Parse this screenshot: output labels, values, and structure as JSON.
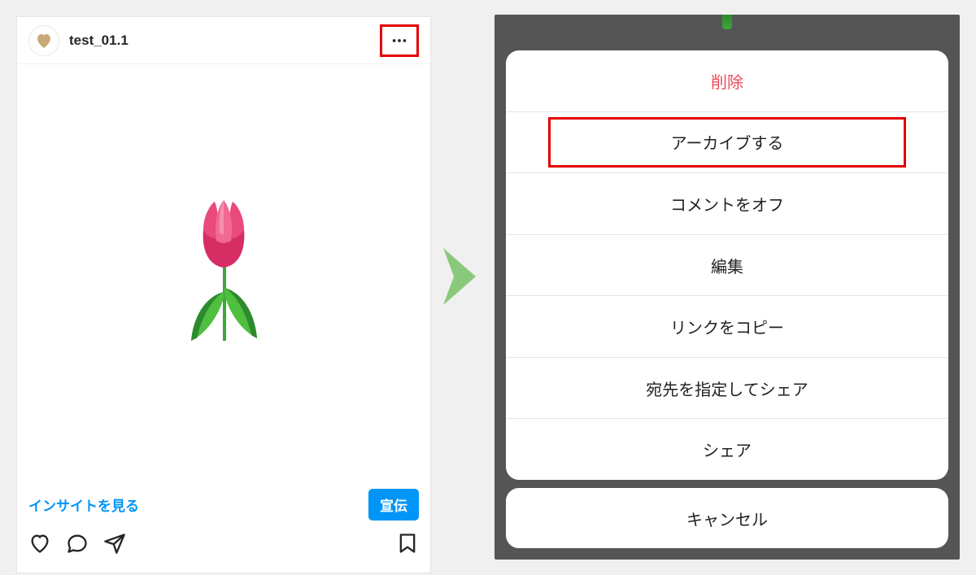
{
  "left": {
    "username": "test_01.1",
    "insights_label": "インサイトを見る",
    "promote_label": "宣伝"
  },
  "sheet": {
    "items": [
      {
        "label": "削除",
        "danger": true,
        "highlighted": false
      },
      {
        "label": "アーカイブする",
        "danger": false,
        "highlighted": true
      },
      {
        "label": "コメントをオフ",
        "danger": false,
        "highlighted": false
      },
      {
        "label": "編集",
        "danger": false,
        "highlighted": false
      },
      {
        "label": "リンクをコピー",
        "danger": false,
        "highlighted": false
      },
      {
        "label": "宛先を指定してシェア",
        "danger": false,
        "highlighted": false
      },
      {
        "label": "シェア",
        "danger": false,
        "highlighted": false
      }
    ],
    "cancel": "キャンセル"
  }
}
